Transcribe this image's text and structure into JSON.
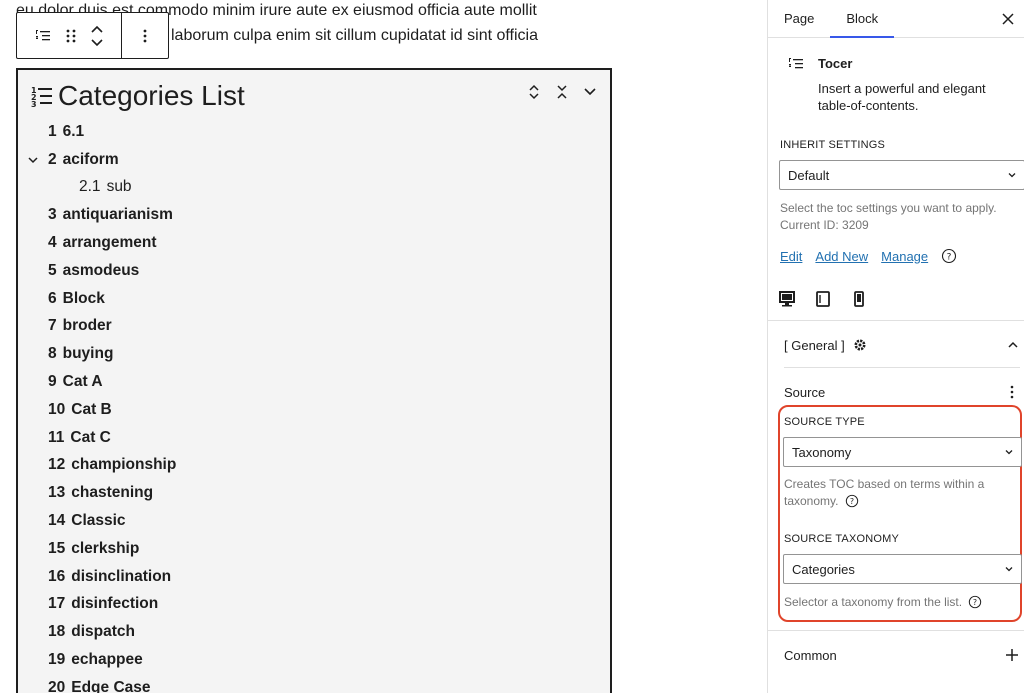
{
  "editor": {
    "paragraph": {
      "line1": "eu dolor duis est commodo minim irure aute ex eiusmod officia aute mollit",
      "line2": "laborum culpa enim sit cillum cupidatat id sint officia"
    },
    "toc": {
      "title": "Categories List",
      "items": [
        {
          "num": "1",
          "label": "6.1"
        },
        {
          "num": "2",
          "label": "aciform",
          "expanded": true
        },
        {
          "num": "2.1",
          "label": "sub",
          "sub": true
        },
        {
          "num": "3",
          "label": "antiquarianism"
        },
        {
          "num": "4",
          "label": "arrangement"
        },
        {
          "num": "5",
          "label": "asmodeus"
        },
        {
          "num": "6",
          "label": "Block"
        },
        {
          "num": "7",
          "label": "broder"
        },
        {
          "num": "8",
          "label": "buying"
        },
        {
          "num": "9",
          "label": "Cat A"
        },
        {
          "num": "10",
          "label": "Cat B"
        },
        {
          "num": "11",
          "label": "Cat C"
        },
        {
          "num": "12",
          "label": "championship"
        },
        {
          "num": "13",
          "label": "chastening"
        },
        {
          "num": "14",
          "label": "Classic"
        },
        {
          "num": "15",
          "label": "clerkship"
        },
        {
          "num": "16",
          "label": "disinclination"
        },
        {
          "num": "17",
          "label": "disinfection"
        },
        {
          "num": "18",
          "label": "dispatch"
        },
        {
          "num": "19",
          "label": "echappee"
        },
        {
          "num": "20",
          "label": "Edge Case"
        }
      ]
    }
  },
  "sidebar": {
    "tabs": [
      "Page",
      "Block"
    ],
    "active_tab": "Block",
    "block": {
      "name": "Tocer",
      "description": "Insert a powerful and elegant table-of-contents."
    },
    "inherit": {
      "label": "INHERIT SETTINGS",
      "value": "Default",
      "help": "Select the toc settings you want to apply. Current ID: 3209"
    },
    "links": {
      "edit": "Edit",
      "add_new": "Add New",
      "manage": "Manage"
    },
    "general": {
      "label": "[ General ]"
    },
    "source": {
      "label": "Source",
      "type_label": "SOURCE TYPE",
      "type_value": "Taxonomy",
      "type_help": "Creates TOC based on terms within a taxonomy.",
      "taxonomy_label": "SOURCE TAXONOMY",
      "taxonomy_value": "Categories",
      "taxonomy_help": "Selector a taxonomy from the list."
    },
    "common": {
      "label": "Common"
    }
  },
  "colors": {
    "accent": "#3858e9",
    "link": "#2271b1",
    "highlight": "#e0442b"
  }
}
